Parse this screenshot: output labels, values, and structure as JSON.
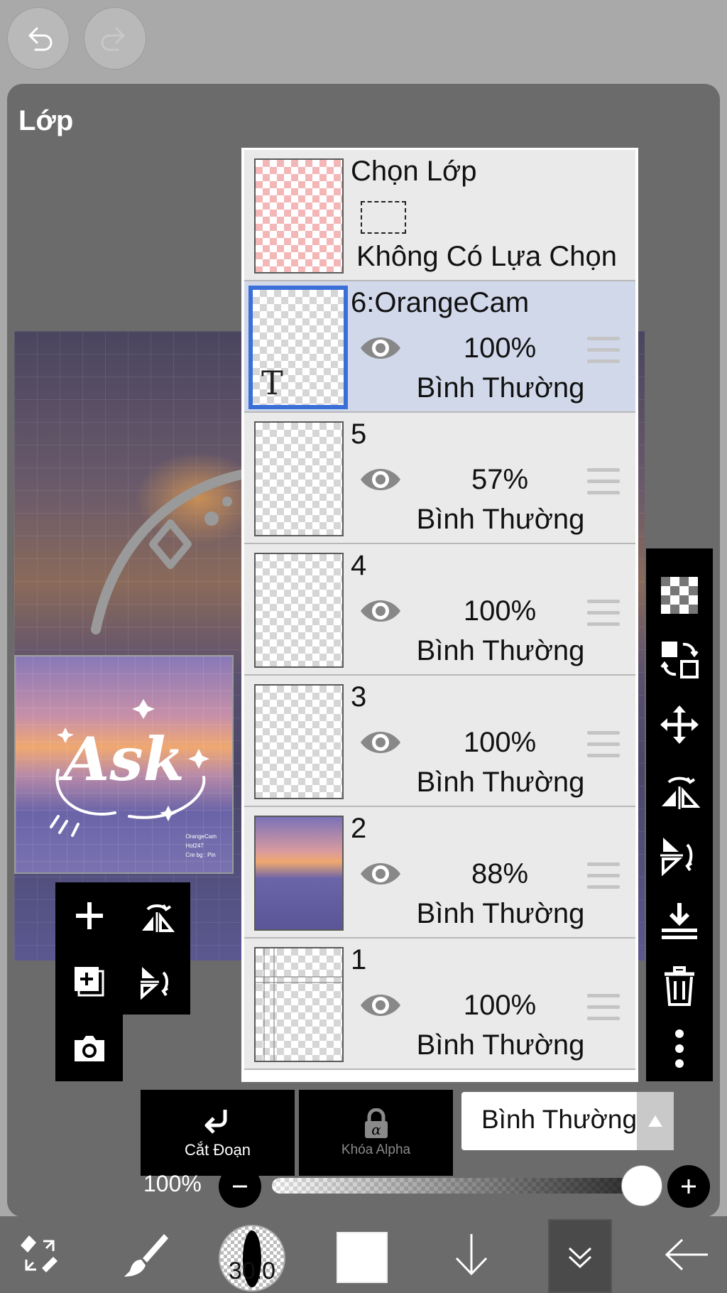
{
  "panel": {
    "title": "Lớp"
  },
  "layers": [
    {
      "name": "6:OrangeCam",
      "opacity": "100%",
      "blend": "Bình Thường",
      "selected": true
    },
    {
      "name": "5",
      "opacity": "57%",
      "blend": "Bình Thường"
    },
    {
      "name": "4",
      "opacity": "100%",
      "blend": "Bình Thường"
    },
    {
      "name": "3",
      "opacity": "100%",
      "blend": "Bình Thường"
    },
    {
      "name": "2",
      "opacity": "88%",
      "blend": "Bình Thường"
    },
    {
      "name": "1",
      "opacity": "100%",
      "blend": "Bình Thường"
    }
  ],
  "selection_layer": {
    "title": "Chọn Lớp",
    "status": "Không Có Lựa Chọn"
  },
  "text_layer_glyph": "T",
  "thumbnail": {
    "word": "Ask",
    "credit": [
      "OrangeCam",
      "Hol247",
      "Cre bg : Pin"
    ]
  },
  "actions": {
    "clipping": "Cắt Đoạn",
    "alpha_lock": "Khóa Alpha",
    "alpha_symbol": "α"
  },
  "blend_mode": {
    "value": "Bình Thường"
  },
  "opacity": {
    "label": "100%",
    "value": 1.0
  },
  "brush": {
    "size": "30.0"
  },
  "colors": {
    "panel": "#6b6b6b",
    "selected_row": "#d0d8ea",
    "selected_border": "#3a6fd8",
    "toolbar": "#000000"
  },
  "icons": {
    "top": [
      "undo-icon",
      "redo-icon"
    ],
    "right_toolbar": [
      "transparency-icon",
      "layer-swap-icon",
      "move-icon",
      "flip-horizontal-icon",
      "flip-vertical-icon",
      "merge-down-icon",
      "trash-icon",
      "more-icon"
    ],
    "left_toolbar": [
      "add-layer-icon",
      "flip-icon",
      "duplicate-layer-icon",
      "rotate-icon",
      "camera-icon"
    ],
    "bottom": [
      "transform-icon",
      "brush-icon",
      "brush-size",
      "color-swatch",
      "arrow-down-icon",
      "layers-chevron-icon",
      "back-icon"
    ]
  }
}
